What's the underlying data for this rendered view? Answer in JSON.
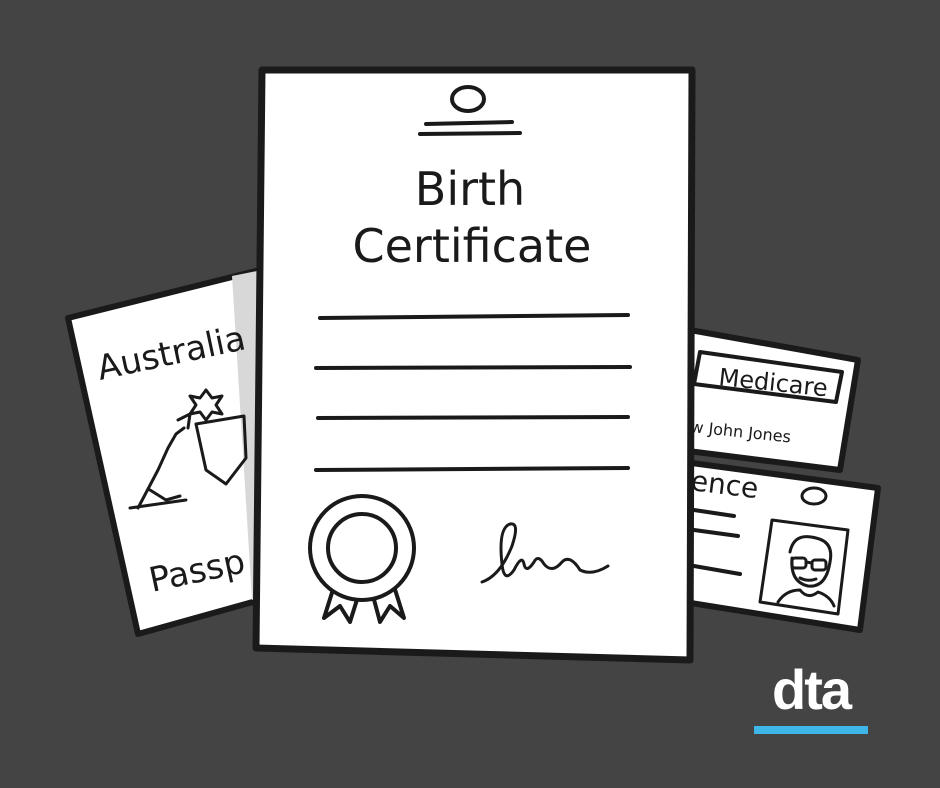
{
  "illustration": {
    "birth_certificate": {
      "title_line1": "Birth",
      "title_line2": "Certificate"
    },
    "passport": {
      "title": "Australia",
      "label": "Passp"
    },
    "medicare_card": {
      "title": "Medicare",
      "name": "w John Jones"
    },
    "licence_card": {
      "title": "ence"
    }
  },
  "brand": {
    "logo_text": "dta",
    "accent_color": "#3fb6e8"
  },
  "colors": {
    "background": "#444444",
    "paper": "#ffffff",
    "ink": "#1a1a1a",
    "shadow": "#d8d8d8"
  }
}
